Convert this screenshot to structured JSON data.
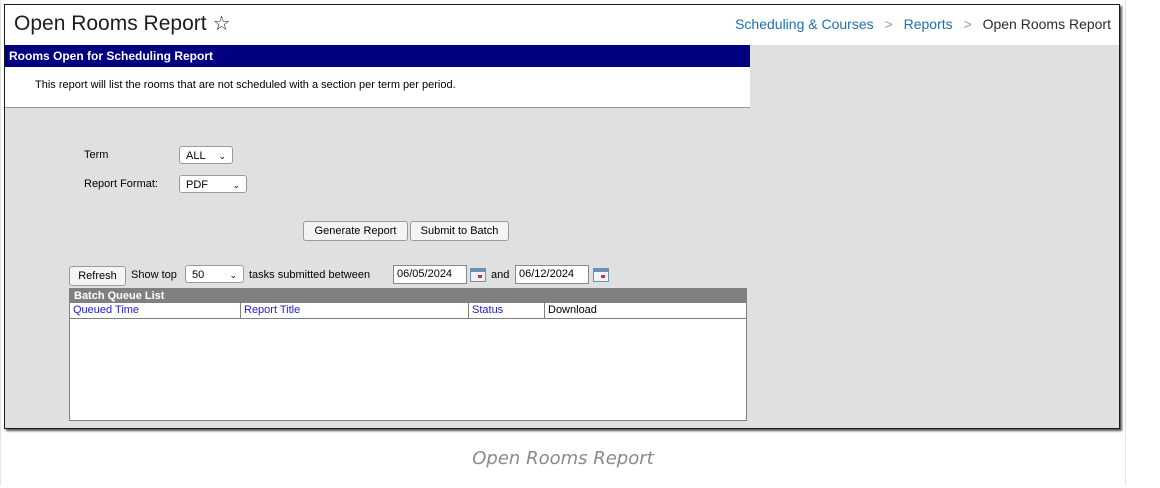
{
  "header": {
    "title": "Open Rooms Report",
    "star_icon": "☆",
    "breadcrumb": [
      "Scheduling & Courses",
      "Reports",
      "Open Rooms Report"
    ],
    "breadcrumb_sep": ">"
  },
  "report": {
    "section_title": "Rooms Open for Scheduling Report",
    "description": "This report will list the rooms that are not scheduled with a section per term per period.",
    "term_label": "Term",
    "term_value": "ALL",
    "format_label": "Report Format:",
    "format_value": "PDF",
    "generate_label": "Generate Report",
    "batch_label": "Submit to Batch"
  },
  "batch_queue": {
    "refresh_label": "Refresh",
    "show_top_label": "Show top",
    "show_top_value": "50",
    "between_label": "tasks submitted between",
    "start_date": "06/05/2024",
    "and_label": "and",
    "end_date": "06/12/2024",
    "list_title": "Batch Queue List",
    "columns": [
      "Queued Time",
      "Report Title",
      "Status",
      "Download"
    ]
  },
  "caption": "Open Rooms Report",
  "colors": {
    "header_bg": "#000080",
    "link": "#1f6fb2",
    "column_link": "#2020cc"
  }
}
